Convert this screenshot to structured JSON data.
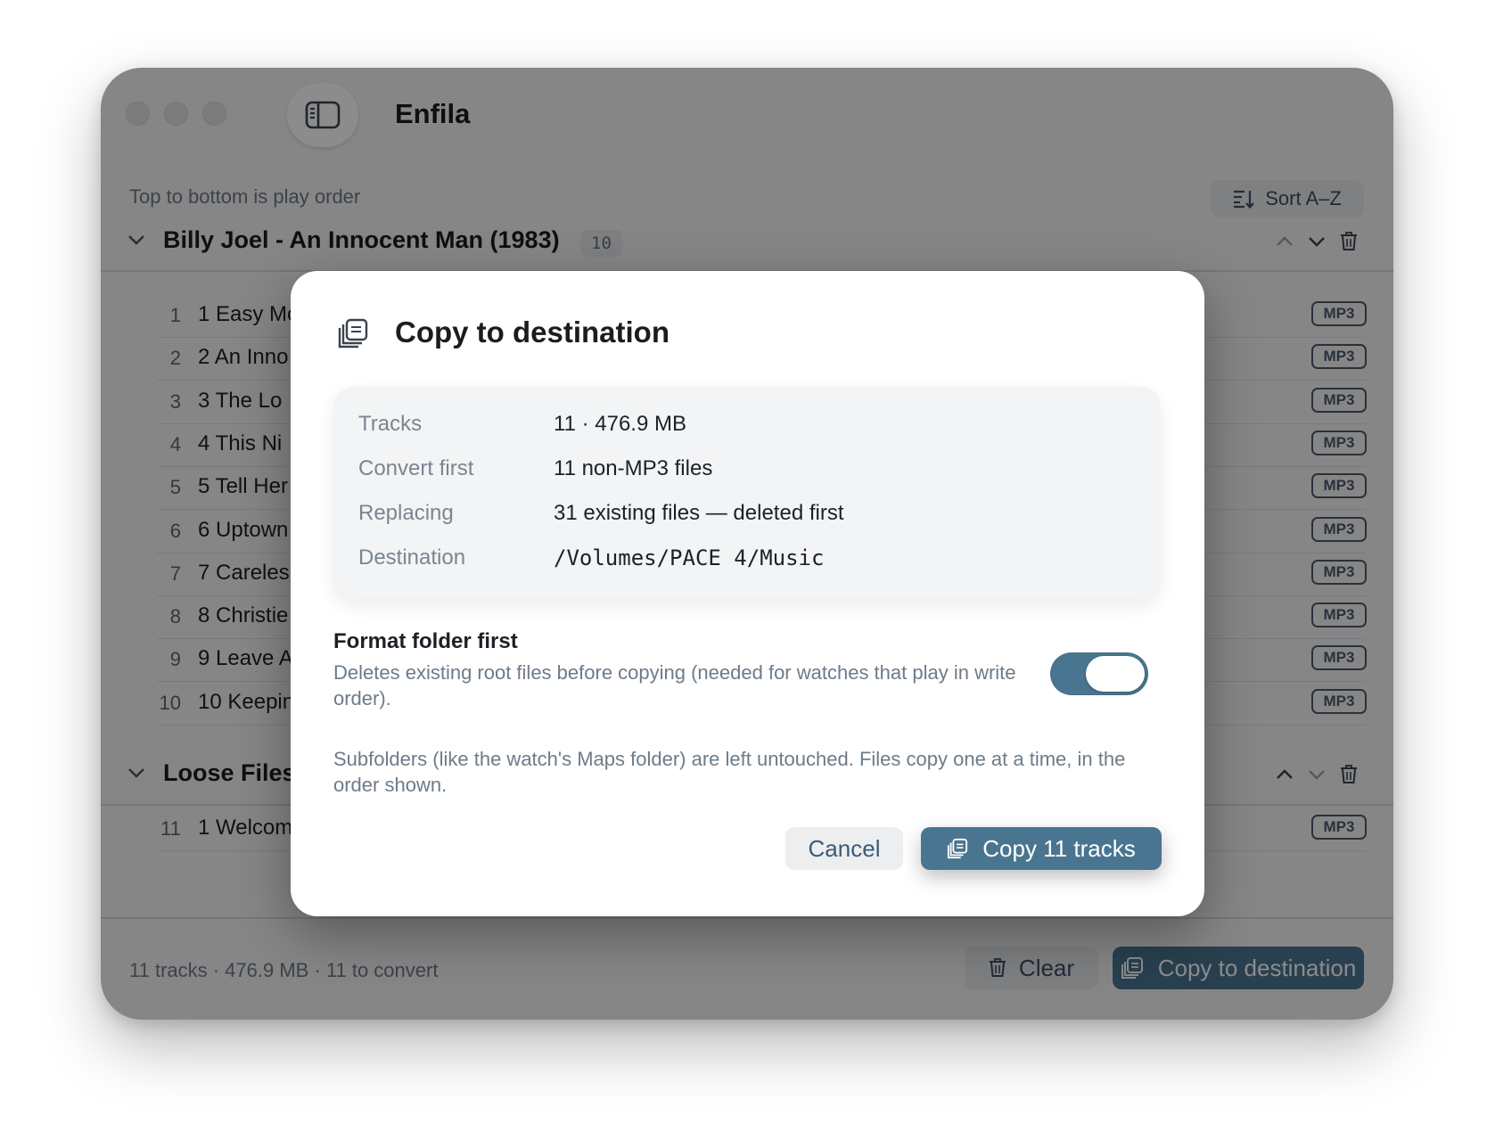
{
  "app": {
    "title": "Enfila"
  },
  "toolbar": {
    "hint": "Top to bottom is play order",
    "sort_label": "Sort A–Z"
  },
  "groups": [
    {
      "title": "Billy Joel - An Innocent Man (1983)",
      "count": "10",
      "tracks": [
        {
          "num": "1",
          "name": "1 Easy Mo",
          "format": "MP3"
        },
        {
          "num": "2",
          "name": "2 An Inno",
          "format": "MP3"
        },
        {
          "num": "3",
          "name": "3 The Lo",
          "format": "MP3"
        },
        {
          "num": "4",
          "name": "4 This Ni",
          "format": "MP3"
        },
        {
          "num": "5",
          "name": "5 Tell Her",
          "format": "MP3"
        },
        {
          "num": "6",
          "name": "6 Uptown",
          "format": "MP3"
        },
        {
          "num": "7",
          "name": "7 Careles",
          "format": "MP3"
        },
        {
          "num": "8",
          "name": "8 Christie",
          "format": "MP3"
        },
        {
          "num": "9",
          "name": "9 Leave A",
          "format": "MP3"
        },
        {
          "num": "10",
          "name": "10 Keepin",
          "format": "MP3"
        }
      ]
    },
    {
      "title": "Loose Files",
      "tracks": [
        {
          "num": "11",
          "name": "1 Welcom",
          "format": "MP3"
        }
      ]
    }
  ],
  "footer": {
    "summary": "11 tracks · 476.9 MB · 11 to convert",
    "clear_label": "Clear",
    "copy_label": "Copy to destination"
  },
  "dialog": {
    "title": "Copy to destination",
    "summary": [
      {
        "label": "Tracks",
        "value": "11 · 476.9 MB"
      },
      {
        "label": "Convert first",
        "value": "11 non-MP3 files"
      },
      {
        "label": "Replacing",
        "value": "31 existing files — deleted first"
      },
      {
        "label": "Destination",
        "value": "/Volumes/PACE 4/Music"
      }
    ],
    "option_title": "Format folder first",
    "option_desc": "Deletes existing root files before copying (needed for watches that play in write order).",
    "option_enabled": true,
    "note": "Subfolders (like the watch's Maps folder) are left untouched. Files copy one at a time, in the order shown.",
    "cancel_label": "Cancel",
    "confirm_label": "Copy 11 tracks"
  },
  "colors": {
    "accent": "#4a7590",
    "badge_border": "#4b5a6a"
  }
}
